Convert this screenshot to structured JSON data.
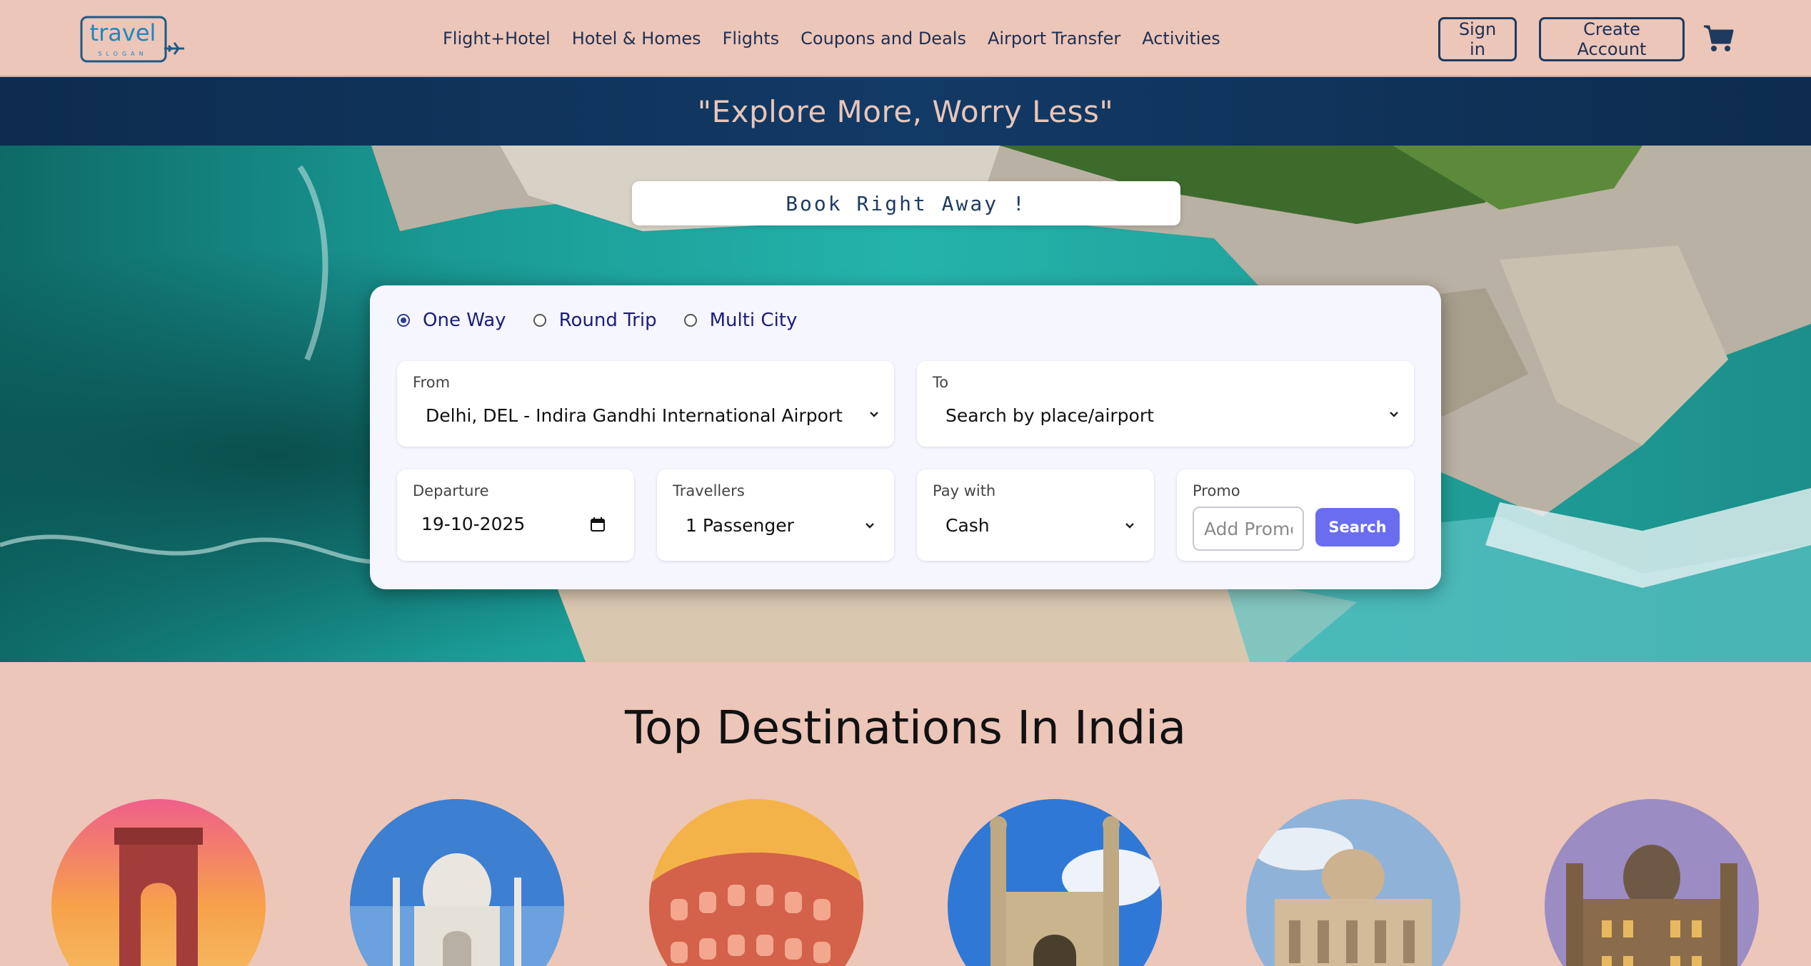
{
  "brand": {
    "logo_text": "travel",
    "logo_subtext": "SLOGAN"
  },
  "nav": {
    "links": [
      "Flight+Hotel",
      "Hotel & Homes",
      "Flights",
      "Coupons and Deals",
      "Airport Transfer",
      "Activities"
    ],
    "sign_in": "Sign in",
    "create_account": "Create Account",
    "cart_icon": "cart-icon"
  },
  "tagline": "\"Explore More, Worry Less\"",
  "hero": {
    "banner": "Book Right Away !",
    "trip_types": [
      {
        "label": "One Way",
        "checked": true
      },
      {
        "label": "Round Trip",
        "checked": false
      },
      {
        "label": "Multi City",
        "checked": false
      }
    ],
    "from": {
      "label": "From",
      "value": "Delhi, DEL - Indira Gandhi International Airport"
    },
    "to": {
      "label": "To",
      "value": "Search by place/airport"
    },
    "departure": {
      "label": "Departure",
      "value": "19-10-2025"
    },
    "travellers": {
      "label": "Travellers",
      "value": "1 Passenger"
    },
    "pay_with": {
      "label": "Pay with",
      "value": "Cash"
    },
    "promo": {
      "label": "Promo",
      "placeholder": "Add Promo",
      "search_label": "Search"
    }
  },
  "destinations": {
    "title": "Top Destinations In India",
    "items": [
      "india-gate",
      "taj-mahal",
      "hawa-mahal",
      "charminar",
      "vidhana-soudha",
      "chhatrapati-shivaji-terminus"
    ]
  },
  "colors": {
    "nav_bg": "#ecc6b8",
    "tagline_bg": "#0d2c4e",
    "accent": "#6b6df0",
    "text_dark": "#1e2f55"
  }
}
